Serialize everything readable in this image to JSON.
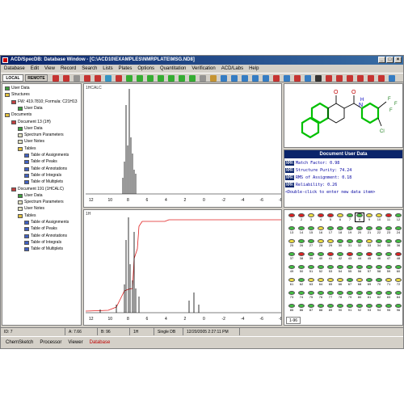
{
  "window": {
    "title": "ACD/SpecDB: Database Window - [C:\\ACD10\\EXAMPLES\\NMRPLATE\\MSG.ND8]"
  },
  "menu": [
    "Database",
    "Edit",
    "View",
    "Record",
    "Search",
    "Lists",
    "Plates",
    "Options",
    "Quantitation",
    "Verification",
    "ACD/Labs",
    "Help"
  ],
  "toolbar": {
    "local": "LOCAL",
    "remote": "REMOTE"
  },
  "tree": [
    {
      "label": "User Data",
      "indent": 0,
      "icon": "data-icon"
    },
    {
      "label": "Structures",
      "indent": 0,
      "icon": "folder-icon"
    },
    {
      "label": "FW: 419.7810; Formula: C21H13",
      "indent": 1,
      "icon": "molecule-icon"
    },
    {
      "label": "User Data",
      "indent": 2,
      "icon": "data-icon"
    },
    {
      "label": "Documents",
      "indent": 0,
      "icon": "folder-icon"
    },
    {
      "label": "Document 13 (1H)",
      "indent": 1,
      "icon": "document-icon"
    },
    {
      "label": "User Data",
      "indent": 2,
      "icon": "data-icon"
    },
    {
      "label": "Spectrum Parameters",
      "indent": 2,
      "icon": "note-icon"
    },
    {
      "label": "User Notes",
      "indent": 2,
      "icon": "note-icon"
    },
    {
      "label": "Tables",
      "indent": 2,
      "icon": "folder-icon"
    },
    {
      "label": "Table of Assignments",
      "indent": 3,
      "icon": "table-icon"
    },
    {
      "label": "Table of Peaks",
      "indent": 3,
      "icon": "table-icon"
    },
    {
      "label": "Table of Annotations",
      "indent": 3,
      "icon": "table-icon"
    },
    {
      "label": "Table of Integrals",
      "indent": 3,
      "icon": "table-icon"
    },
    {
      "label": "Table of Multiplets",
      "indent": 3,
      "icon": "table-icon"
    },
    {
      "label": "Document 191 (1HCALC)",
      "indent": 1,
      "icon": "document-icon"
    },
    {
      "label": "User Data",
      "indent": 2,
      "icon": "data-icon"
    },
    {
      "label": "Spectrum Parameters",
      "indent": 2,
      "icon": "note-icon"
    },
    {
      "label": "User Notes",
      "indent": 2,
      "icon": "note-icon"
    },
    {
      "label": "Tables",
      "indent": 2,
      "icon": "folder-icon"
    },
    {
      "label": "Table of Assignments",
      "indent": 3,
      "icon": "table-icon"
    },
    {
      "label": "Table of Peaks",
      "indent": 3,
      "icon": "table-icon"
    },
    {
      "label": "Table of Annotations",
      "indent": 3,
      "icon": "table-icon"
    },
    {
      "label": "Table of Integrals",
      "indent": 3,
      "icon": "table-icon"
    },
    {
      "label": "Table of Multiplets",
      "indent": 3,
      "icon": "table-icon"
    }
  ],
  "spectrum_top": {
    "label": "1HCALC",
    "axis_ticks": [
      "12",
      "10",
      "8",
      "6",
      "4",
      "2",
      "0",
      "-2",
      "-4",
      "-6",
      "-8"
    ]
  },
  "spectrum_bottom": {
    "label": "1H",
    "axis_ticks": [
      "12",
      "10",
      "8",
      "6",
      "4",
      "2",
      "0",
      "-2",
      "-4",
      "-6",
      "-8"
    ]
  },
  "structure": {
    "atoms": [
      "O",
      "O",
      "N",
      "H",
      "F",
      "F",
      "F",
      "Cl"
    ]
  },
  "user_data": {
    "header": "Document User Data",
    "rows": [
      {
        "key": "NMR",
        "text": "Match Factor: 0.98"
      },
      {
        "key": "NMR",
        "text": "Structure Purity: 74.24"
      },
      {
        "key": "NMR",
        "text": "RMS of Assignment: 0.18"
      },
      {
        "key": "NMR",
        "text": "Reliability: 0.26"
      },
      {
        "key": "",
        "text": "<Double-click to enter new data item>"
      }
    ]
  },
  "plate": {
    "numbers": [
      1,
      2,
      3,
      4,
      5,
      6,
      7,
      8,
      9,
      10,
      11,
      12,
      13,
      14,
      15,
      16,
      17,
      18,
      19,
      20,
      21,
      22,
      23,
      24,
      25,
      26,
      27,
      28,
      29,
      30,
      31,
      32,
      33,
      34,
      35,
      36,
      37,
      38,
      39,
      40,
      41,
      42,
      43,
      44,
      45,
      46,
      47,
      48,
      49,
      50,
      51,
      52,
      53,
      54,
      55,
      56,
      57,
      58,
      59,
      60,
      61,
      62,
      63,
      64,
      65,
      66,
      67,
      68,
      69,
      70,
      71,
      72,
      73,
      74,
      75,
      76,
      77,
      78,
      79,
      80,
      81,
      82,
      83,
      84,
      85,
      86,
      87,
      88,
      89,
      90,
      91,
      92,
      93,
      94,
      95,
      96
    ],
    "colors": [
      "#e02020",
      "#e02020",
      "#f0e040",
      "#e02020",
      "#e02020",
      "#f0e040",
      "#40c040",
      "#40c040",
      "#f0e040",
      "#f0e040",
      "#e02020",
      "#40c040",
      "#40c040",
      "#40c040",
      "#40c040",
      "#f0e040",
      "#40c040",
      "#40c040",
      "#40c040",
      "#40c040",
      "#40c040",
      "#40c040",
      "#40c040",
      "#40c040",
      "#f0e040",
      "#40c040",
      "#40c040",
      "#f0e040",
      "#f0e040",
      "#40c040",
      "#40c040",
      "#40c040",
      "#f0e040",
      "#40c040",
      "#40c040",
      "#40c040",
      "#40c040",
      "#e02020",
      "#40c040",
      "#40c040",
      "#e02020",
      "#40c040",
      "#e02020",
      "#40c040",
      "#e02020",
      "#40c040",
      "#40c040",
      "#e02020",
      "#40c040",
      "#40c040",
      "#40c040",
      "#40c040",
      "#40c040",
      "#40c040",
      "#40c040",
      "#40c040",
      "#40c040",
      "#40c040",
      "#40c040",
      "#40c040",
      "#f0e040",
      "#40c040",
      "#f0e040",
      "#f0e040",
      "#f0e040",
      "#f0e040",
      "#40c040",
      "#f0e040",
      "#40c040",
      "#40c040",
      "#f0e040",
      "#f0e040",
      "#40c040",
      "#40c040",
      "#40c040",
      "#40c040",
      "#40c040",
      "#40c040",
      "#40c040",
      "#40c040",
      "#40c040",
      "#40c040",
      "#40c040",
      "#40c040",
      "#40c040",
      "#40c040",
      "#40c040",
      "#40c040",
      "#40c040",
      "#40c040",
      "#40c040",
      "#40c040",
      "#40c040",
      "#40c040",
      "#40c040",
      "#40c040"
    ],
    "tab": "1-96",
    "selected": 8
  },
  "status": {
    "id": "ID: 7",
    "a": "A: 7.66",
    "b": "B: 96",
    "nucleus": "1H",
    "mode": "Single DB",
    "datetime": "12/20/2005 2:27:11 PM"
  },
  "bottom_tabs": [
    "ChemSketch",
    "Processor",
    "Viewer",
    "Database"
  ]
}
